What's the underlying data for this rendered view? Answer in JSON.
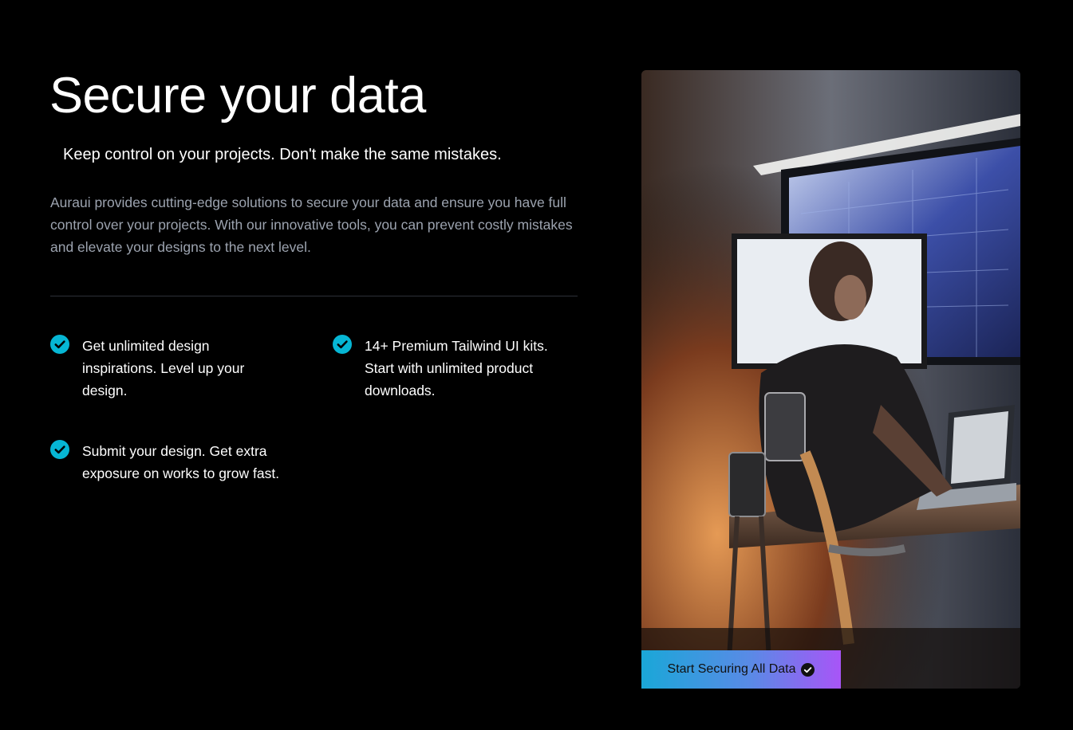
{
  "hero": {
    "title": "Secure your data",
    "subtitle": "Keep control on your projects. Don't make the same mistakes.",
    "description": "Auraui provides cutting-edge solutions to secure your data and ensure you have full control over your projects. With our innovative tools, you can prevent costly mistakes and elevate your designs to the next level."
  },
  "features": [
    {
      "text": "Get unlimited design inspirations. Level up your design.",
      "icon": "check-circle-icon"
    },
    {
      "text": "14+ Premium Tailwind UI kits. Start with unlimited product downloads.",
      "icon": "check-circle-icon"
    },
    {
      "text": "Submit your design. Get extra exposure on works to grow fast.",
      "icon": "check-circle-icon"
    }
  ],
  "cta": {
    "label": "Start Securing All Data",
    "icon": "check-circle-icon"
  },
  "colors": {
    "background": "#000000",
    "accent": "#06b6d4",
    "muted_text": "#9ca3af",
    "gradient_start": "#1aa7d8",
    "gradient_end": "#a855f7"
  }
}
